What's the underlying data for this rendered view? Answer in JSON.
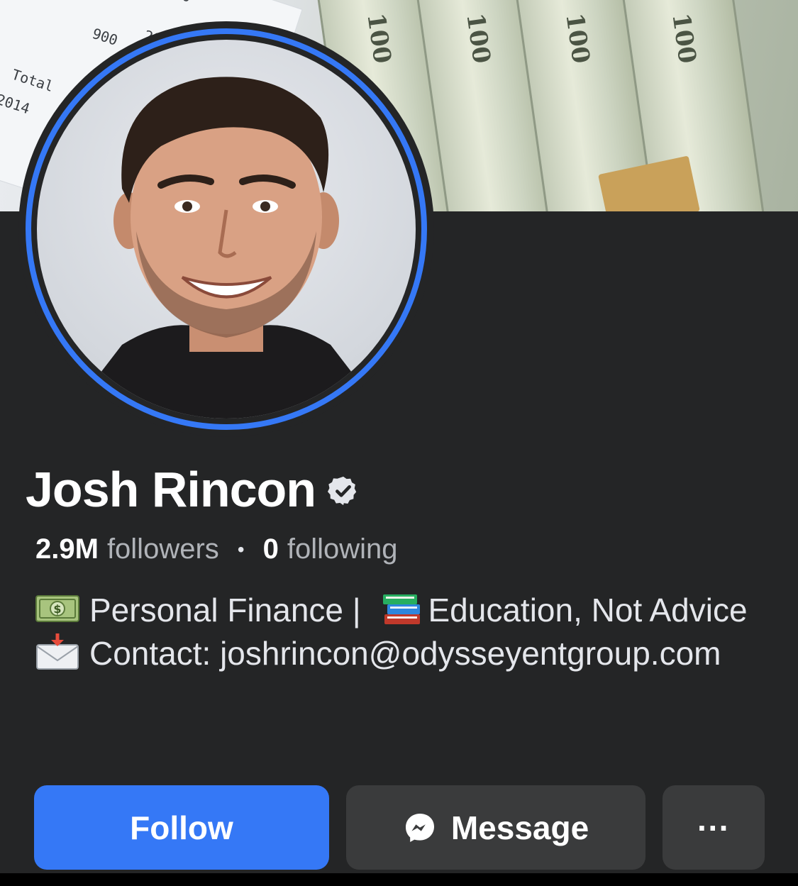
{
  "profile": {
    "name": "Josh Rincon",
    "verified": true,
    "followers_count": "2.9M",
    "followers_label": "followers",
    "separator": "•",
    "following_count": "0",
    "following_label": "following"
  },
  "bio": {
    "line1_text": "Personal Finance |",
    "line1_text2": "Education, Not Advice",
    "line2_text": "Contact: joshrincon@odysseyentgroup.com",
    "icons": [
      "money-bill-icon",
      "books-icon",
      "envelope-icon"
    ]
  },
  "actions": {
    "follow_label": "Follow",
    "message_label": "Message",
    "more_label": "···"
  },
  "colors": {
    "background": "#242526",
    "accent": "#3578f6",
    "secondary_button": "#3a3b3c"
  }
}
